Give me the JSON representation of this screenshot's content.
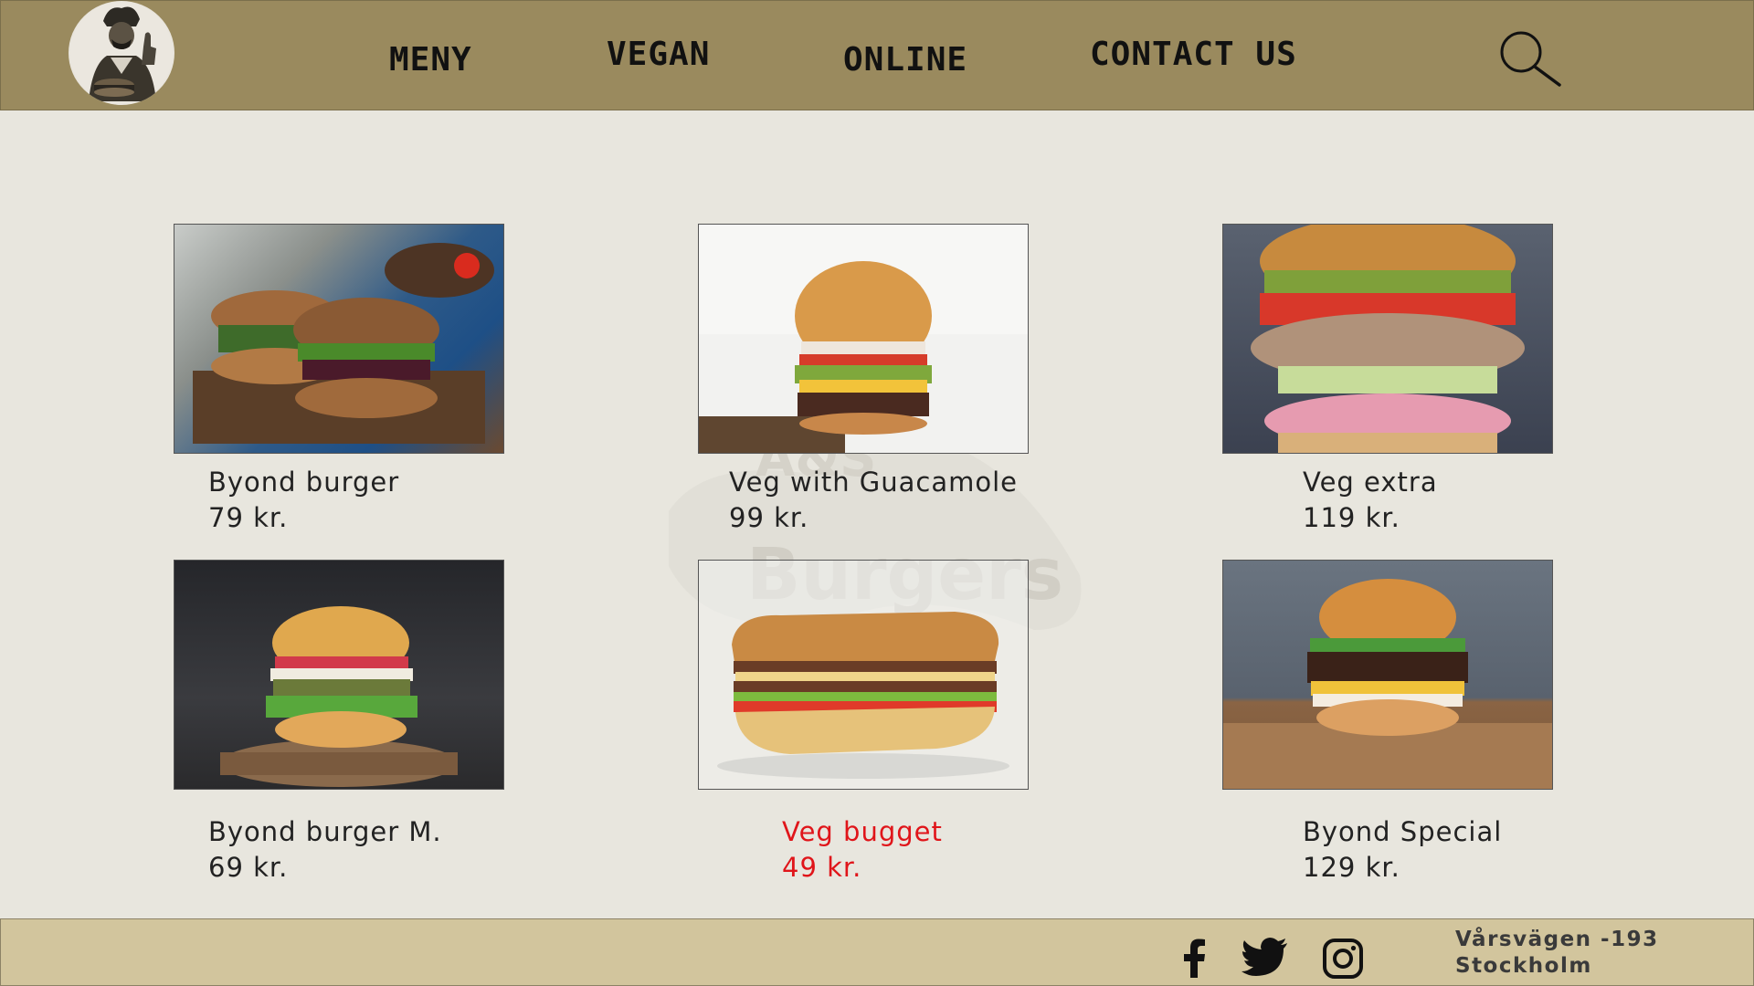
{
  "nav": {
    "items": [
      {
        "label": "MENY"
      },
      {
        "label": "VEGAN"
      },
      {
        "label": "ONLINE"
      },
      {
        "label": "CONTACT US"
      }
    ]
  },
  "products": [
    {
      "name": "Byond burger",
      "price": "79 kr."
    },
    {
      "name": "Veg with Guacamole",
      "price": "99 kr."
    },
    {
      "name": "Veg extra",
      "price": "119 kr."
    },
    {
      "name": "Byond burger M.",
      "price": "69 kr."
    },
    {
      "name": "Veg bugget",
      "price": "49 kr.",
      "highlighted": true
    },
    {
      "name": "Byond Special",
      "price": "129 kr."
    }
  ],
  "watermark": {
    "line1": "A&S",
    "line2": "Burgers"
  },
  "footer": {
    "social": [
      "facebook-icon",
      "twitter-icon",
      "instagram-icon"
    ],
    "address_line1": "Vårsvägen -193",
    "address_line2": "Stockholm"
  },
  "colors": {
    "header": "#9a8a5e",
    "background": "#e8e6de",
    "footer": "#d2c59d",
    "highlight": "#e0151a"
  }
}
